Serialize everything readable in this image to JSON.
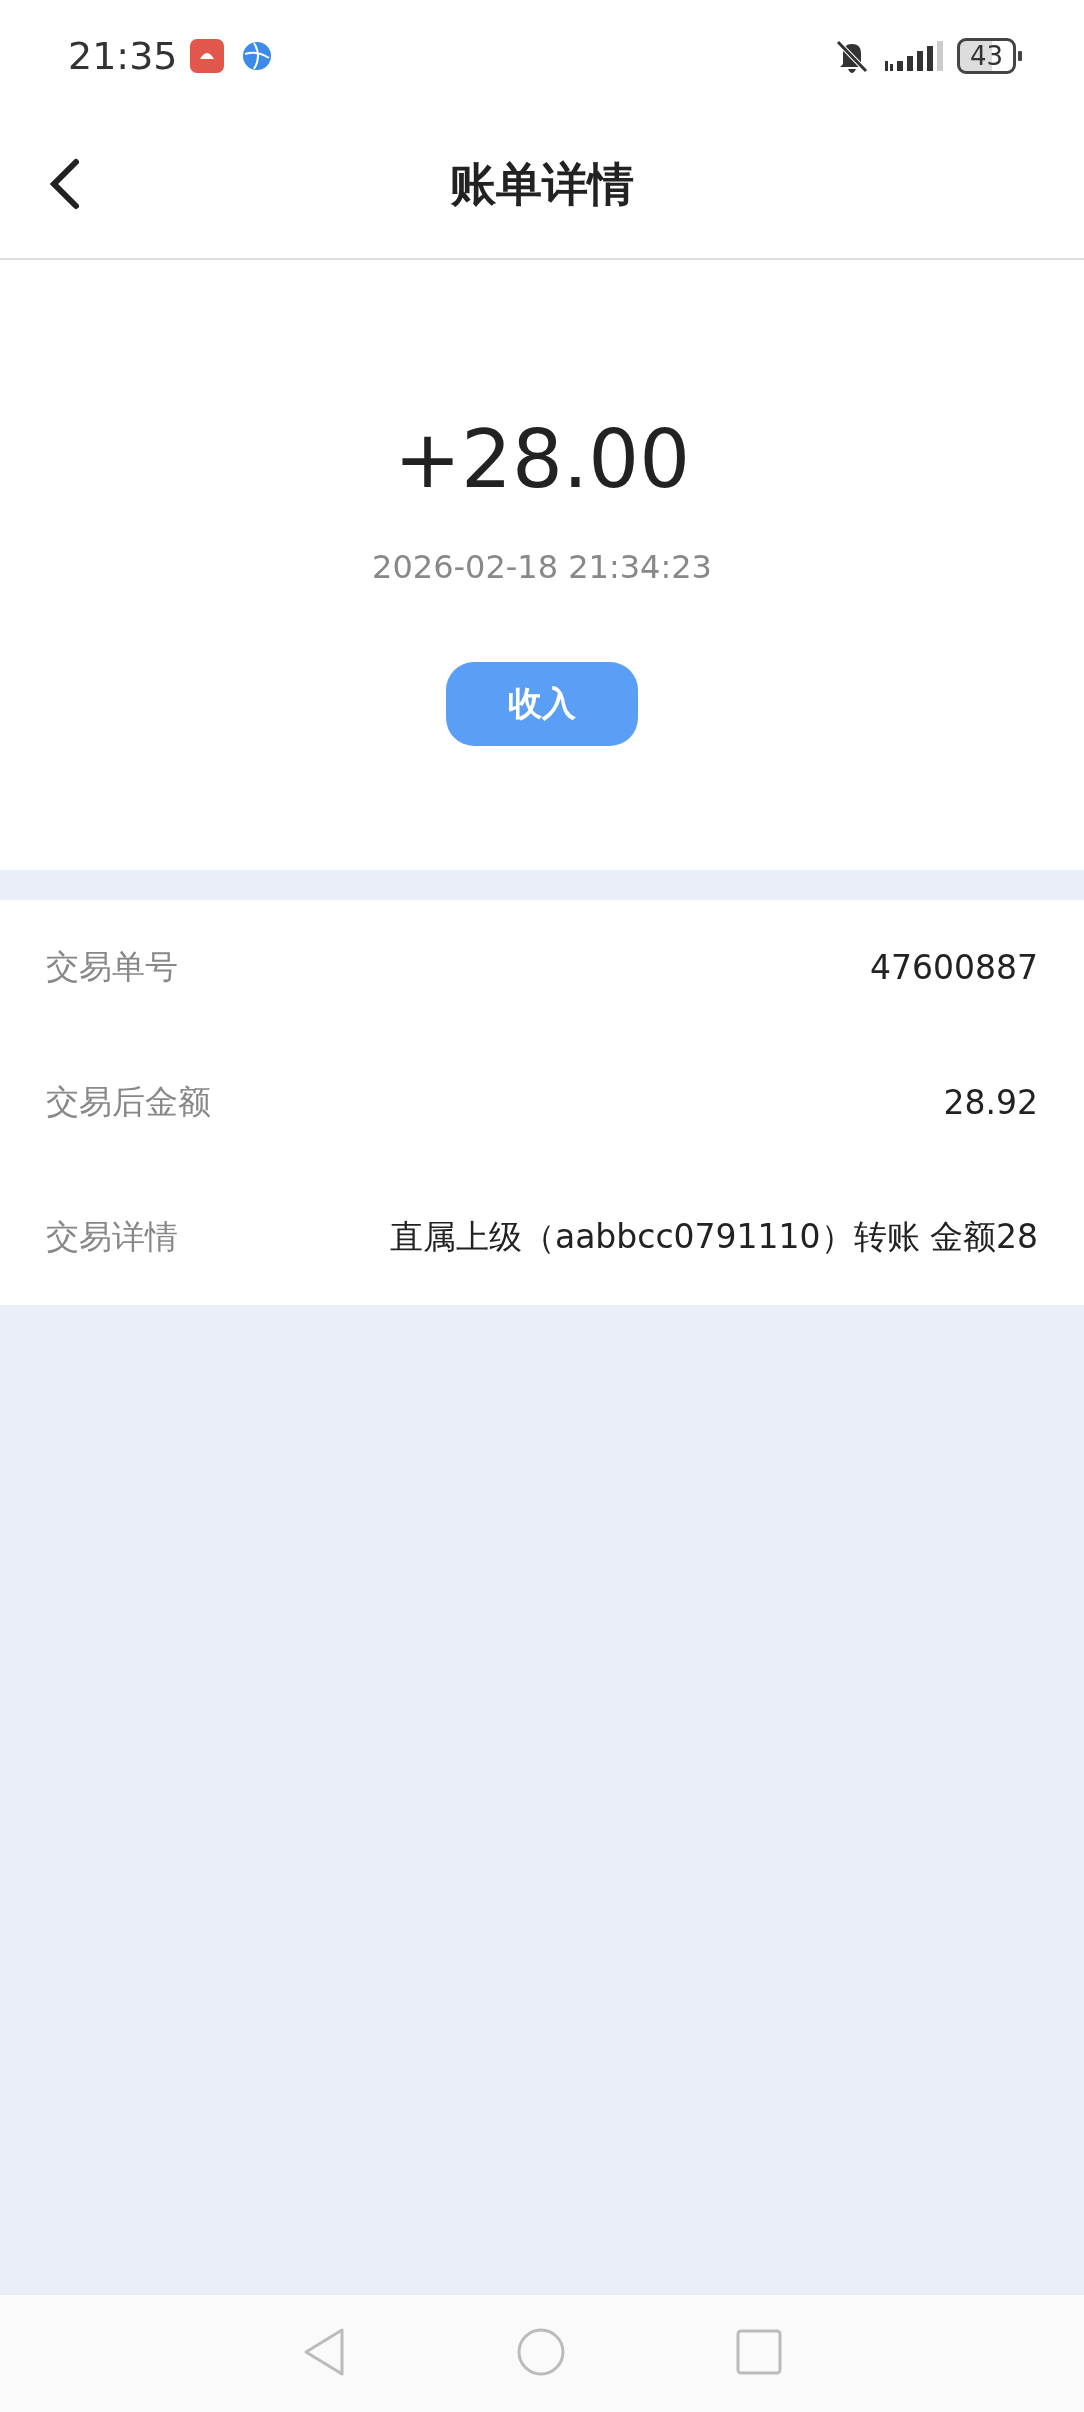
{
  "status_bar": {
    "time": "21:35",
    "battery": "43"
  },
  "header": {
    "title": "账单详情"
  },
  "summary": {
    "amount": "+28.00",
    "datetime": "2026-02-18 21:34:23",
    "type_badge": "收入"
  },
  "details": [
    {
      "label": "交易单号",
      "value": "47600887"
    },
    {
      "label": "交易后金额",
      "value": "28.92"
    },
    {
      "label": "交易详情",
      "value": "直属上级（aabbcc0791110）转账 金额28"
    }
  ]
}
